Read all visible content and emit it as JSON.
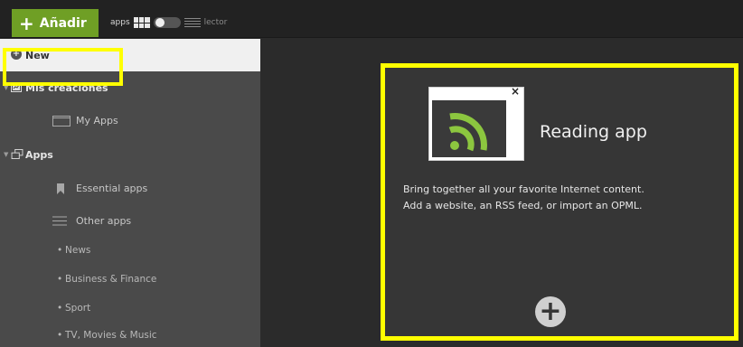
{
  "topbar": {
    "add_label": "Añadir",
    "mode_left": "apps",
    "mode_right": "lector"
  },
  "sidebar": {
    "new_label": "New",
    "sections": [
      {
        "label": "Mis creaciones",
        "children": [
          {
            "label": "My Apps"
          }
        ]
      },
      {
        "label": "Apps",
        "children": [
          {
            "label": "Essential apps"
          },
          {
            "label": "Other apps"
          }
        ]
      }
    ],
    "categories": [
      "News",
      "Business & Finance",
      "Sport",
      "TV, Movies & Music"
    ]
  },
  "card": {
    "title": "Reading app",
    "description_line1": "Bring together all your favorite Internet content.",
    "description_line2": "Add a website, an RSS feed, or import an OPML.",
    "icon": "rss-icon"
  },
  "colors": {
    "accent_green": "#6f9f25",
    "rss_green": "#8cc63f",
    "highlight": "#ffff00"
  }
}
